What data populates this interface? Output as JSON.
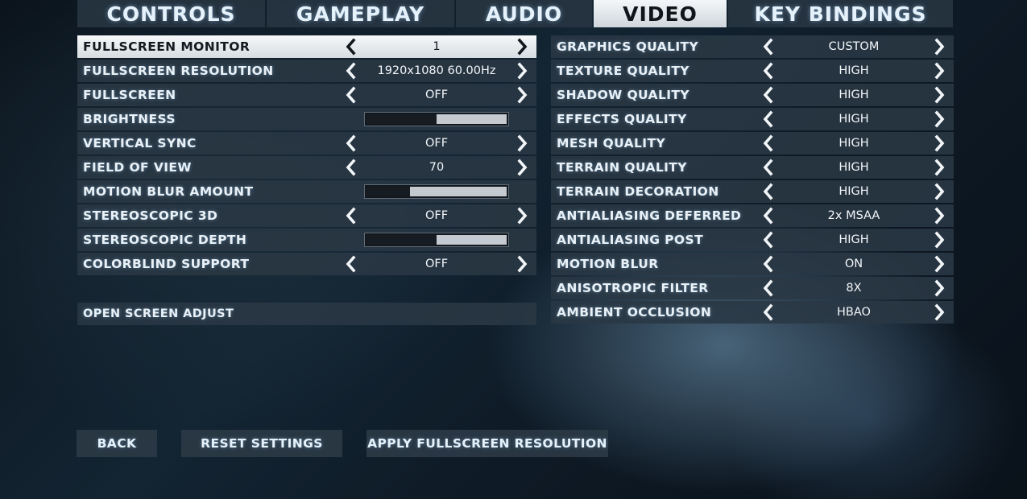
{
  "tabs": [
    {
      "label": "CONTROLS",
      "active": false
    },
    {
      "label": "GAMEPLAY",
      "active": false
    },
    {
      "label": "AUDIO",
      "active": false
    },
    {
      "label": "VIDEO",
      "active": true
    },
    {
      "label": "KEY BINDINGS",
      "active": false
    }
  ],
  "left_settings": [
    {
      "label": "FULLSCREEN MONITOR",
      "type": "selector",
      "value": "1",
      "selected": true
    },
    {
      "label": "FULLSCREEN RESOLUTION",
      "type": "selector",
      "value": "1920x1080 60.00Hz"
    },
    {
      "label": "FULLSCREEN",
      "type": "selector",
      "value": "OFF"
    },
    {
      "label": "BRIGHTNESS",
      "type": "slider",
      "level": 0.5
    },
    {
      "label": "VERTICAL SYNC",
      "type": "selector",
      "value": "OFF"
    },
    {
      "label": "FIELD OF VIEW",
      "type": "selector",
      "value": "70"
    },
    {
      "label": "MOTION BLUR AMOUNT",
      "type": "slider",
      "level": 0.31
    },
    {
      "label": "STEREOSCOPIC 3D",
      "type": "selector",
      "value": "OFF"
    },
    {
      "label": "STEREOSCOPIC DEPTH",
      "type": "slider",
      "level": 0.5
    },
    {
      "label": "COLORBLIND SUPPORT",
      "type": "selector",
      "value": "OFF"
    }
  ],
  "screen_adjust_label": "OPEN SCREEN ADJUST",
  "right_settings": [
    {
      "label": "GRAPHICS QUALITY",
      "value": "CUSTOM"
    },
    {
      "label": "TEXTURE QUALITY",
      "value": "HIGH"
    },
    {
      "label": "SHADOW QUALITY",
      "value": "HIGH"
    },
    {
      "label": "EFFECTS QUALITY",
      "value": "HIGH"
    },
    {
      "label": "MESH QUALITY",
      "value": "HIGH"
    },
    {
      "label": "TERRAIN QUALITY",
      "value": "HIGH"
    },
    {
      "label": "TERRAIN DECORATION",
      "value": "HIGH"
    },
    {
      "label": "ANTIALIASING DEFERRED",
      "value": "2x MSAA"
    },
    {
      "label": "ANTIALIASING POST",
      "value": "HIGH"
    },
    {
      "label": "MOTION BLUR",
      "value": "ON"
    },
    {
      "label": "ANISOTROPIC FILTER",
      "value": "8X"
    },
    {
      "label": "AMBIENT OCCLUSION",
      "value": "HBAO"
    }
  ],
  "buttons": {
    "back": "BACK",
    "reset": "RESET SETTINGS",
    "apply": "APPLY FULLSCREEN RESOLUTION"
  }
}
